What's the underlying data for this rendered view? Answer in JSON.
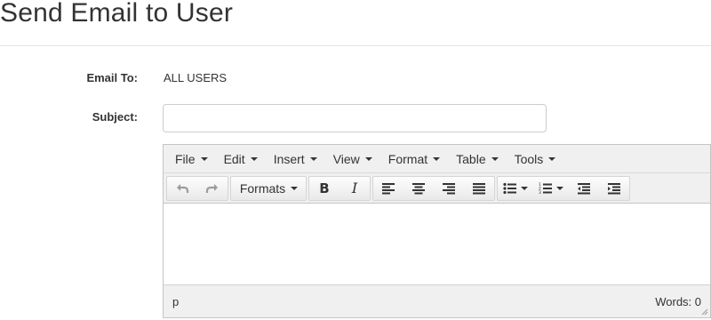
{
  "page": {
    "title": "Send Email to User"
  },
  "form": {
    "email_to_label": "Email To:",
    "email_to_value": "ALL USERS",
    "subject_label": "Subject:",
    "subject_value": "",
    "subject_placeholder": ""
  },
  "editor": {
    "menus": [
      "File",
      "Edit",
      "Insert",
      "View",
      "Format",
      "Table",
      "Tools"
    ],
    "toolbar": {
      "formats_label": "Formats",
      "bold_glyph": "B",
      "italic_glyph": "I"
    },
    "status": {
      "path": "p",
      "word_count": "Words: 0"
    },
    "icons": [
      "undo-icon",
      "redo-icon",
      "align-left-icon",
      "align-center-icon",
      "align-right-icon",
      "align-justify-icon",
      "bullet-list-icon",
      "numbered-list-icon",
      "outdent-icon",
      "indent-icon",
      "resize-handle-icon"
    ]
  }
}
